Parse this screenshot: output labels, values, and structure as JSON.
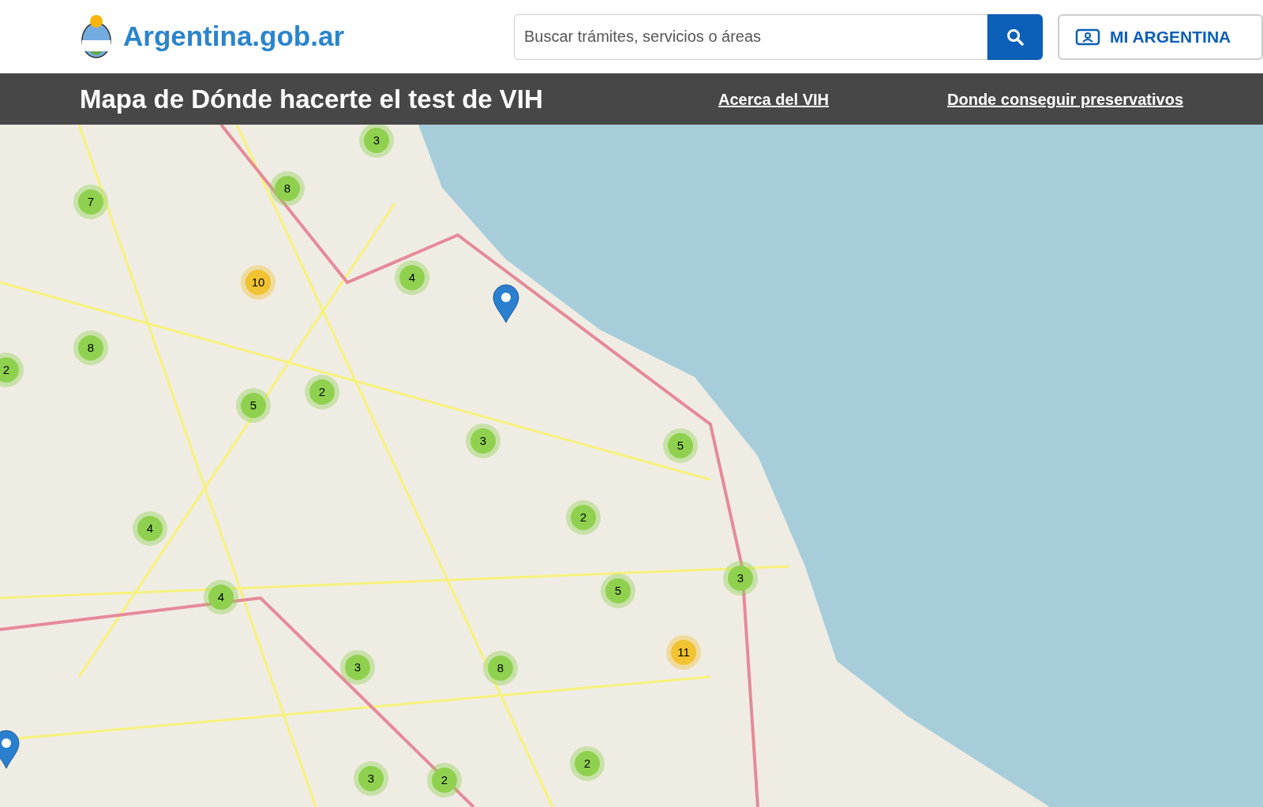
{
  "header": {
    "logo_text": "Argentina.gob.ar",
    "search": {
      "placeholder": "Buscar trámites, servicios o áreas"
    },
    "login_button": "MI ARGENTINA"
  },
  "title_bar": {
    "title": "Mapa de Dónde hacerte el test de VIH",
    "links": [
      "Acerca del VIH",
      "Donde conseguir preservativos"
    ]
  },
  "map": {
    "clusters": [
      {
        "count": "3",
        "color": "#8fd14f"
      },
      {
        "count": "8",
        "color": "#8fd14f"
      },
      {
        "count": "7",
        "color": "#8fd14f"
      },
      {
        "count": "10",
        "color": "#f1c232"
      },
      {
        "count": "4",
        "color": "#8fd14f"
      },
      {
        "count": "8",
        "color": "#8fd14f"
      },
      {
        "count": "2",
        "color": "#8fd14f"
      },
      {
        "count": "2",
        "color": "#8fd14f"
      },
      {
        "count": "5",
        "color": "#8fd14f"
      },
      {
        "count": "3",
        "color": "#8fd14f"
      },
      {
        "count": "5",
        "color": "#8fd14f"
      },
      {
        "count": "2",
        "color": "#8fd14f"
      },
      {
        "count": "4",
        "color": "#8fd14f"
      },
      {
        "count": "3",
        "color": "#8fd14f"
      },
      {
        "count": "4",
        "color": "#8fd14f"
      },
      {
        "count": "5",
        "color": "#8fd14f"
      },
      {
        "count": "11",
        "color": "#f1c232"
      },
      {
        "count": "3",
        "color": "#8fd14f"
      },
      {
        "count": "8",
        "color": "#8fd14f"
      },
      {
        "count": "2",
        "color": "#8fd14f"
      },
      {
        "count": "3",
        "color": "#8fd14f"
      },
      {
        "count": "2",
        "color": "#8fd14f"
      }
    ]
  }
}
